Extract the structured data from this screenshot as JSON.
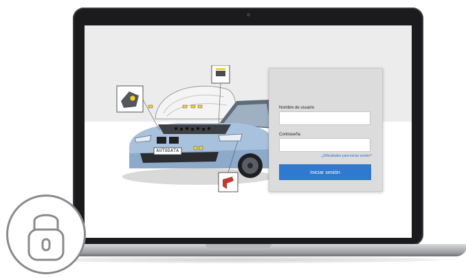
{
  "login": {
    "username_label": "Nombre de usuario",
    "password_label": "Contraseña",
    "forgot_link": "¿Dificultades para iniciar sesión?",
    "submit_label": "Iniciar sesión",
    "username_value": "",
    "password_value": ""
  },
  "car": {
    "plate_text": "AUTODATA"
  },
  "colors": {
    "accent": "#2f79cf",
    "panel": "#dcdcdd",
    "link": "#2c6fc3",
    "laptop_bezel": "#1b1b1d"
  },
  "icons": {
    "lock": "padlock-icon"
  }
}
